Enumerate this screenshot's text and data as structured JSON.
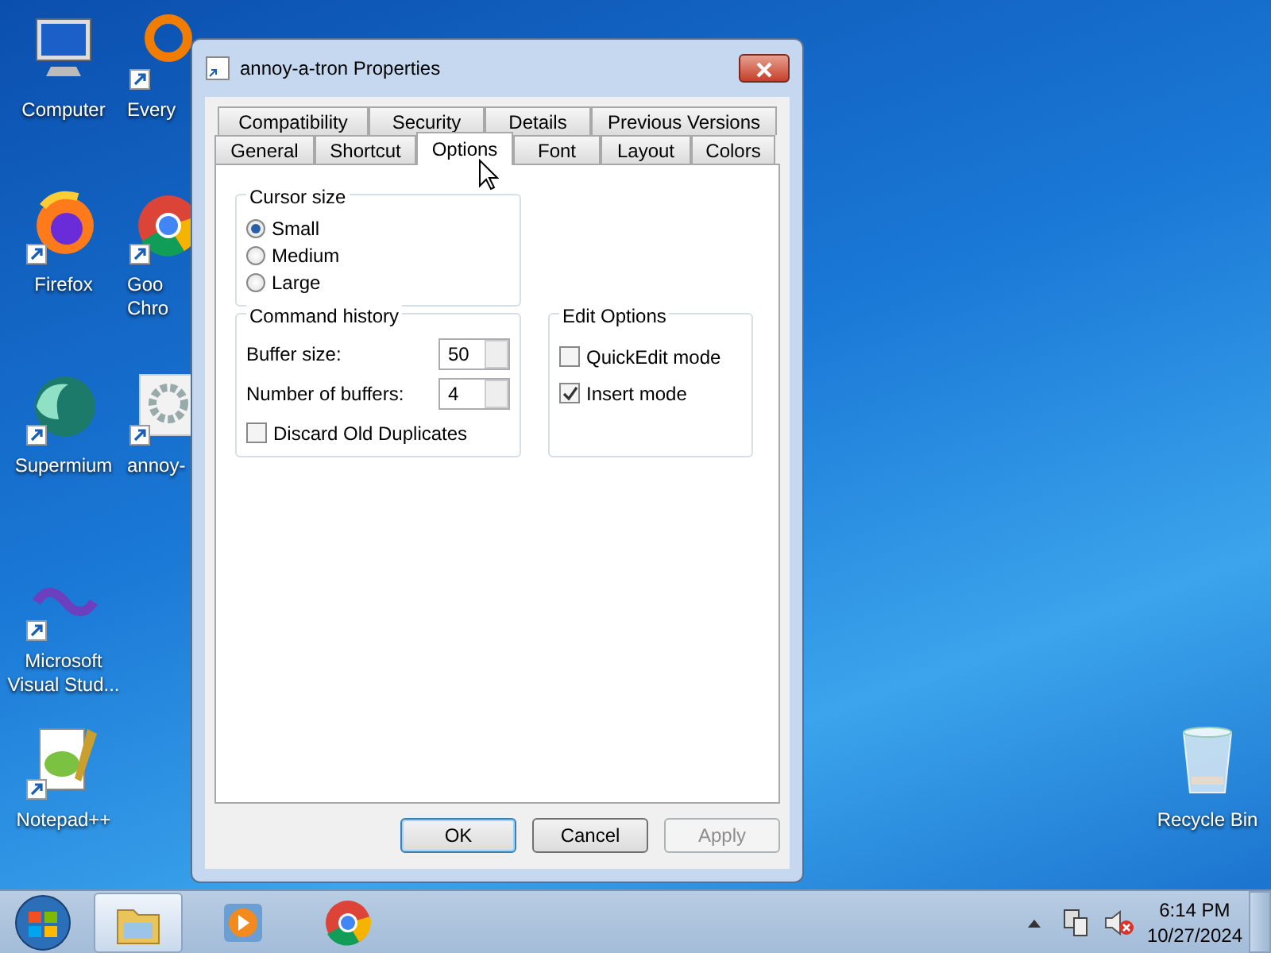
{
  "desktop_icons": [
    {
      "kind": "computer",
      "label": "Computer"
    },
    {
      "kind": "firefox",
      "label": "Firefox"
    },
    {
      "kind": "supermium",
      "label": "Supermium"
    },
    {
      "kind": "visualstudio",
      "label": "Microsoft Visual Stud..."
    },
    {
      "kind": "notepad",
      "label": "Notepad++"
    },
    {
      "kind": "ring",
      "label": "Every"
    },
    {
      "kind": "chrome",
      "label": "Goo Chro"
    },
    {
      "kind": "gear",
      "label": "annoy-"
    },
    {
      "kind": "recycle",
      "label": "Recycle Bin"
    }
  ],
  "dialog": {
    "title": "annoy-a-tron Properties",
    "tab_rows": [
      [
        {
          "label": "Compatibility",
          "selected": false
        },
        {
          "label": "Security",
          "selected": false
        },
        {
          "label": "Details",
          "selected": false
        },
        {
          "label": "Previous Versions",
          "selected": false
        }
      ],
      [
        {
          "label": "General",
          "selected": false
        },
        {
          "label": "Shortcut",
          "selected": false
        },
        {
          "label": "Options",
          "selected": true
        },
        {
          "label": "Font",
          "selected": false
        },
        {
          "label": "Layout",
          "selected": false
        },
        {
          "label": "Colors",
          "selected": false
        }
      ]
    ],
    "cursor_size": {
      "title": "Cursor size",
      "options": [
        {
          "label": "Small",
          "selected": true
        },
        {
          "label": "Medium",
          "selected": false
        },
        {
          "label": "Large",
          "selected": false
        }
      ]
    },
    "command_history": {
      "title": "Command history",
      "fields": [
        {
          "label": "Buffer size:",
          "value": "50"
        },
        {
          "label": "Number of buffers:",
          "value": "4"
        }
      ],
      "discard": {
        "label": "Discard Old Duplicates",
        "checked": false
      }
    },
    "edit_options": {
      "title": "Edit Options",
      "options": [
        {
          "label": "QuickEdit mode",
          "checked": false
        },
        {
          "label": "Insert mode",
          "checked": true
        }
      ]
    },
    "buttons": [
      {
        "label": "OK",
        "default": true,
        "disabled": false
      },
      {
        "label": "Cancel",
        "default": false,
        "disabled": false
      },
      {
        "label": "Apply",
        "default": false,
        "disabled": true
      }
    ]
  },
  "taskbar": {
    "items": [
      {
        "kind": "explorer",
        "active": true
      },
      {
        "kind": "media",
        "active": false
      },
      {
        "kind": "chrome",
        "active": false
      }
    ],
    "clock": {
      "time": "6:14 PM",
      "date": "10/27/2024"
    }
  }
}
